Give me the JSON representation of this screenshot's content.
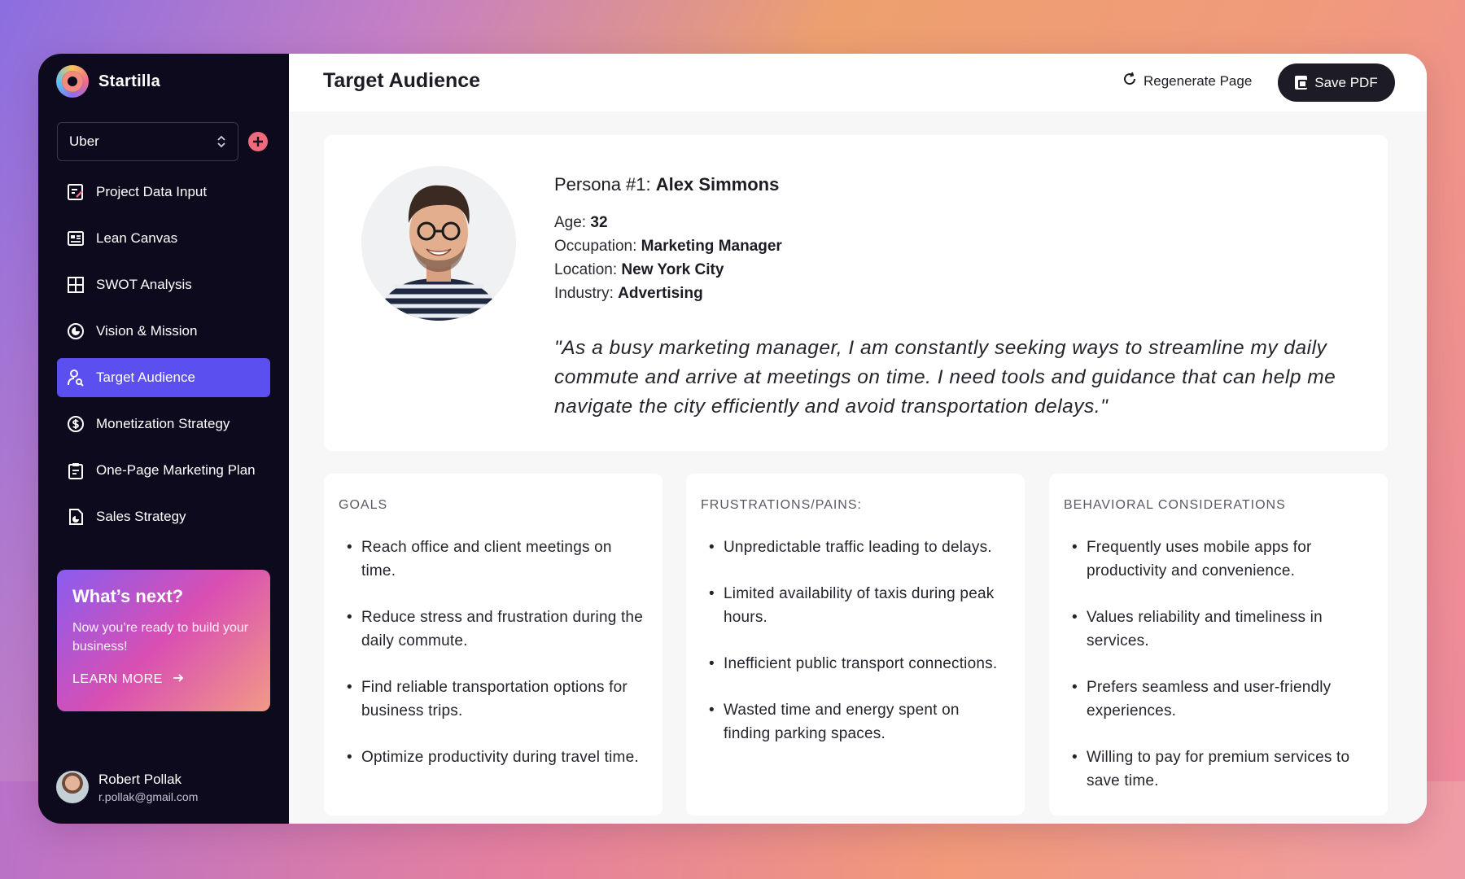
{
  "brand": {
    "name": "Startilla"
  },
  "project_select": {
    "value": "Uber"
  },
  "nav": [
    {
      "label": "Project Data Input",
      "icon": "edit-form-icon",
      "active": false
    },
    {
      "label": "Lean Canvas",
      "icon": "canvas-icon",
      "active": false
    },
    {
      "label": "SWOT Analysis",
      "icon": "grid-icon",
      "active": false
    },
    {
      "label": "Vision & Mission",
      "icon": "target-icon",
      "active": false
    },
    {
      "label": "Target Audience",
      "icon": "user-search-icon",
      "active": true
    },
    {
      "label": "Monetization Strategy",
      "icon": "dollar-icon",
      "active": false
    },
    {
      "label": "One-Page Marketing Plan",
      "icon": "clipboard-icon",
      "active": false
    },
    {
      "label": "Sales Strategy",
      "icon": "chart-doc-icon",
      "active": false
    }
  ],
  "promo": {
    "title": "What’s next?",
    "text": "Now you’re ready to build your business!",
    "link": "LEARN MORE"
  },
  "user": {
    "name": "Robert Pollak",
    "email": "r.pollak@gmail.com"
  },
  "header": {
    "title": "Target Audience",
    "regenerate_label": "Regenerate Page",
    "save_label": "Save PDF"
  },
  "persona": {
    "prefix": "Persona #1: ",
    "name": "Alex Simmons",
    "age_label": "Age: ",
    "age": "32",
    "occupation_label": "Occupation: ",
    "occupation": "Marketing Manager",
    "location_label": "Location: ",
    "location": "New York City",
    "industry_label": "Industry: ",
    "industry": "Advertising",
    "quote": "\"As a busy marketing manager, I am constantly seeking ways to streamline my daily commute and arrive at meetings on time. I need tools and guidance that can help me navigate the city efficiently and avoid transportation delays.\""
  },
  "columns": [
    {
      "title": "GOALS",
      "items": [
        "Reach office and client meetings on time.",
        "Reduce stress and frustration during the daily commute.",
        "Find reliable transportation options for business trips.",
        "Optimize productivity during travel time."
      ]
    },
    {
      "title": "FRUSTRATIONS/PAINS:",
      "items": [
        "Unpredictable traffic leading to delays.",
        "Limited availability of taxis during peak hours.",
        "Inefficient public transport connections.",
        "Wasted time and energy spent on finding parking spaces."
      ]
    },
    {
      "title": "BEHAVIORAL CONSIDERATIONS",
      "items": [
        "Frequently uses mobile apps for productivity and convenience.",
        "Values reliability and timeliness in services.",
        "Prefers seamless and user-friendly experiences.",
        "Willing to pay for premium services to save time."
      ]
    }
  ],
  "colors": {
    "sidebar_bg": "#0d0a1e",
    "active_nav": "#5b4ff0",
    "accent_add": "#f06a7c",
    "save_button": "#1d1b25"
  }
}
